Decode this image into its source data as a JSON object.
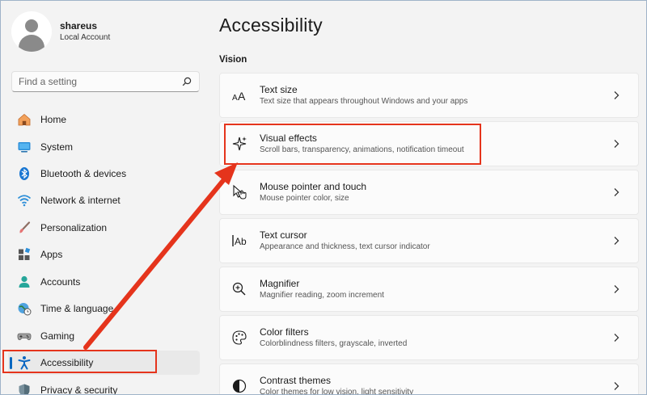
{
  "profile": {
    "name": "shareus",
    "account_type": "Local Account"
  },
  "search": {
    "placeholder": "Find a setting"
  },
  "nav": {
    "items": [
      {
        "label": "Home",
        "icon": "home-icon"
      },
      {
        "label": "System",
        "icon": "system-icon"
      },
      {
        "label": "Bluetooth & devices",
        "icon": "bluetooth-icon"
      },
      {
        "label": "Network & internet",
        "icon": "network-icon"
      },
      {
        "label": "Personalization",
        "icon": "personalization-icon"
      },
      {
        "label": "Apps",
        "icon": "apps-icon"
      },
      {
        "label": "Accounts",
        "icon": "accounts-icon"
      },
      {
        "label": "Time & language",
        "icon": "time-language-icon"
      },
      {
        "label": "Gaming",
        "icon": "gaming-icon"
      },
      {
        "label": "Accessibility",
        "icon": "accessibility-icon",
        "active": true
      },
      {
        "label": "Privacy & security",
        "icon": "privacy-icon"
      }
    ]
  },
  "main": {
    "title": "Accessibility",
    "section": "Vision",
    "cards": [
      {
        "title": "Text size",
        "description": "Text size that appears throughout Windows and your apps",
        "icon": "text-size-icon"
      },
      {
        "title": "Visual effects",
        "description": "Scroll bars, transparency, animations, notification timeout",
        "icon": "visual-effects-icon"
      },
      {
        "title": "Mouse pointer and touch",
        "description": "Mouse pointer color, size",
        "icon": "mouse-pointer-icon"
      },
      {
        "title": "Text cursor",
        "description": "Appearance and thickness, text cursor indicator",
        "icon": "text-cursor-icon"
      },
      {
        "title": "Magnifier",
        "description": "Magnifier reading, zoom increment",
        "icon": "magnifier-icon"
      },
      {
        "title": "Color filters",
        "description": "Colorblindness filters, grayscale, inverted",
        "icon": "color-filters-icon"
      },
      {
        "title": "Contrast themes",
        "description": "Color themes for low vision, light sensitivity",
        "icon": "contrast-themes-icon"
      }
    ]
  },
  "colors": {
    "accent": "#0067c0",
    "highlight": "#e5341c",
    "background": "#f3f3f3",
    "card": "#fbfbfb"
  }
}
